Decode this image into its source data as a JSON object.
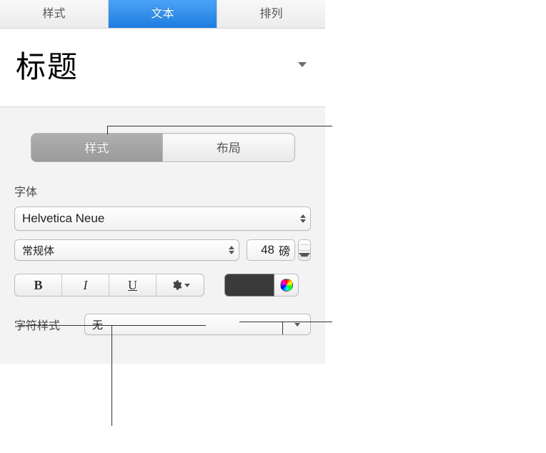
{
  "tabs": {
    "style": "样式",
    "text": "文本",
    "arrange": "排列"
  },
  "styleTitle": "标题",
  "subTabs": {
    "style": "样式",
    "layout": "布局"
  },
  "font": {
    "label": "字体",
    "family": "Helvetica Neue",
    "weight": "常规体",
    "size": "48",
    "unit": "磅"
  },
  "buttons": {
    "bold": "B",
    "italic": "I",
    "underline": "U"
  },
  "color": "#3a3a3a",
  "charStyle": {
    "label": "字符样式",
    "value": "无"
  }
}
